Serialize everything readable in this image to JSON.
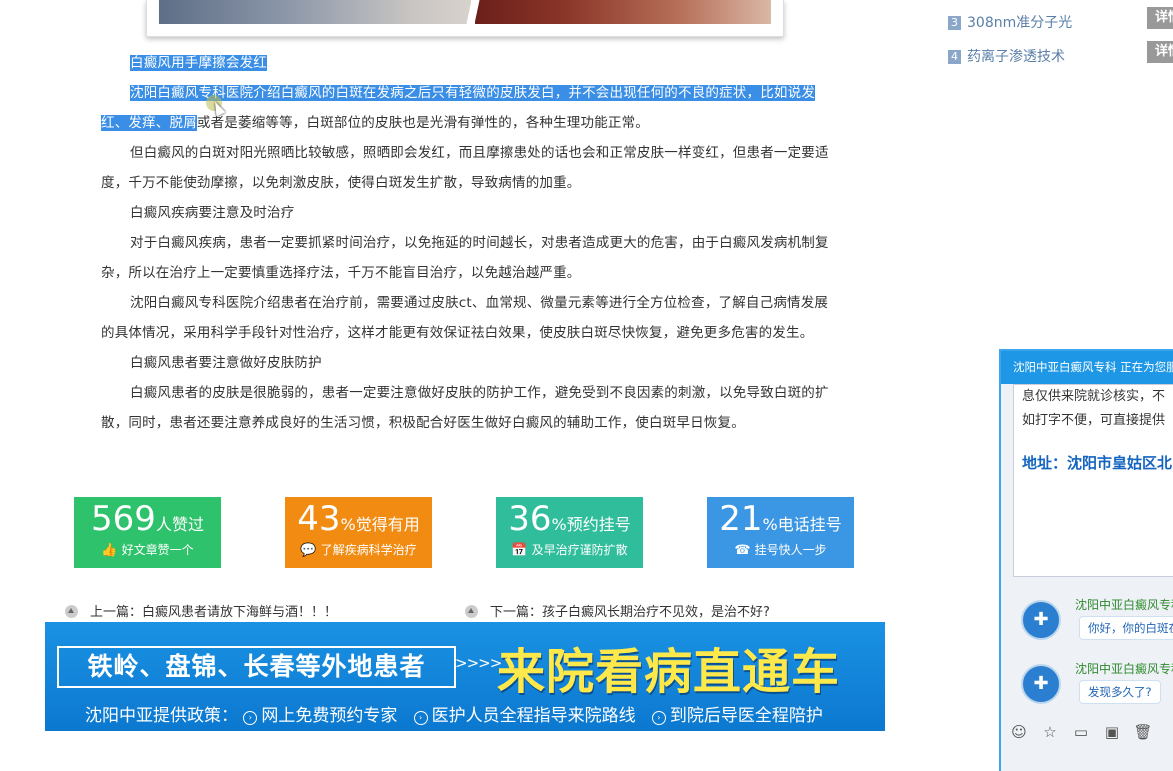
{
  "article": {
    "p1": "白癜风用手摩擦会发红",
    "p2_sel": "沈阳白癜风专科医院介绍白癜风的白斑在发病之后只有轻微的皮肤发白，并不会出现任何的不良的症状，比如说",
    "p2_sel2": "发红、发痒、脱屑",
    "p2_rest": "或者是萎缩等等，白斑部位的皮肤也是光滑有弹性的，各种生理功能正常。",
    "p3": "但白癜风的白斑对阳光照晒比较敏感，照晒即会发红，而且摩擦患处的话也会和正常皮肤一样变红，但患者一定要适度，千万不能使劲摩擦，以免刺激皮肤，使得白斑发生扩散，导致病情的加重。",
    "p4": "白癜风疾病要注意及时治疗",
    "p5": "对于白癜风疾病，患者一定要抓紧时间治疗，以免拖延的时间越长，对患者造成更大的危害，由于白癜风发病机制复杂，所以在治疗上一定要慎重选择疗法，千万不能盲目治疗，以免越治越严重。",
    "p6": "沈阳白癜风专科医院介绍患者在治疗前，需要通过皮肤ct、血常规、微量元素等进行全方位检查，了解自己病情发展的具体情况，采用科学手段针对性治疗，这样才能更有效保证祛白效果，使皮肤白斑尽快恢复，避免更多危害的发生。",
    "p7": "白癜风患者要注意做好皮肤防护",
    "p8": "白癜风患者的皮肤是很脆弱的，患者一定要注意做好皮肤的防护工作，避免受到不良因素的刺激，以免导致白斑的扩散，同时，患者还要注意养成良好的生活习惯，积极配合好医生做好白癜风的辅助工作，使白斑早日恢复。"
  },
  "stats": [
    {
      "num": "569",
      "unit": "人赞过",
      "sub": "好文章赞一个",
      "icon": "thumbs-up-icon",
      "glyph": "👍",
      "color": "#2dc26b"
    },
    {
      "num": "43",
      "unit": "%觉得有用",
      "sub": "了解疾病科学治疗",
      "icon": "chat-icon",
      "glyph": "💬",
      "color": "#f28b12"
    },
    {
      "num": "36",
      "unit": "%预约挂号",
      "sub": "及早治疗谨防扩散",
      "icon": "calendar-icon",
      "glyph": "📅",
      "color": "#2fbd9b"
    },
    {
      "num": "21",
      "unit": "%电话挂号",
      "sub": "挂号快人一步",
      "icon": "phone-icon",
      "glyph": "☎",
      "color": "#3b97e3"
    }
  ],
  "nav": {
    "prev": "上一篇：白癜风患者请放下海鲜与酒！！！",
    "next": "下一篇：孩子白癜风长期治疗不见效，是治不好?"
  },
  "banner": {
    "box": "铁岭、盘锦、长春等外地患者",
    "arrows": ">>>>",
    "big": "来院看病直通车",
    "policy": "沈阳中亚提供政策：",
    "items": [
      "网上免费预约专家",
      "医护人员全程指导来院路线",
      "到院后导医全程陪护"
    ]
  },
  "sidebar": {
    "items": [
      {
        "num": "3",
        "label": "308nm准分子光"
      },
      {
        "num": "4",
        "label": "药离子渗透技术"
      }
    ],
    "detail": "详情"
  },
  "chat": {
    "header": "沈阳中亚白癜风专科 正在为您服务",
    "line1": "息仅供来院就诊核实，不",
    "line2": "如打字不便，可直接提供",
    "address": "地址：沈阳市皇姑区北",
    "agent1": "沈阳中亚白癜风专科",
    "msg1": "你好，你的白斑在",
    "agent2": "沈阳中亚白癜风专科",
    "msg2": "发现多久了?"
  }
}
